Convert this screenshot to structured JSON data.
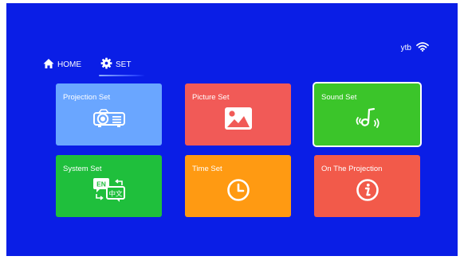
{
  "status": {
    "user": "ytb",
    "wifi_icon": "wifi-icon"
  },
  "nav": {
    "items": [
      {
        "label": "HOME",
        "icon": "home-icon",
        "active": false
      },
      {
        "label": "SET",
        "icon": "gear-icon",
        "active": true
      }
    ]
  },
  "tiles": [
    {
      "label": "Projection Set",
      "color": "#6aa6ff",
      "icon": "projector-icon"
    },
    {
      "label": "Picture Set",
      "color": "#f15a57",
      "icon": "picture-icon"
    },
    {
      "label": "Sound Set",
      "color": "#3bc52a",
      "icon": "sound-icon",
      "selected": true
    },
    {
      "label": "System Set",
      "color": "#1fbf3c",
      "icon": "language-icon",
      "icon_text": {
        "en": "EN",
        "zh": "中文"
      }
    },
    {
      "label": "Time Set",
      "color": "#ff9a12",
      "icon": "clock-icon"
    },
    {
      "label": "On The Projection",
      "color": "#f25a4a",
      "icon": "info-icon"
    }
  ]
}
